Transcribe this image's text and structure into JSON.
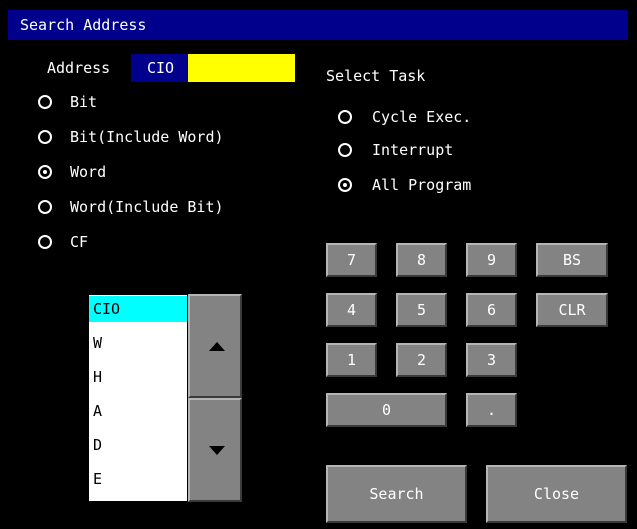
{
  "title": "Search Address",
  "address": {
    "label": "Address",
    "area": "CIO",
    "value": ""
  },
  "modes": [
    {
      "label": "Bit",
      "selected": false
    },
    {
      "label": "Bit(Include Word)",
      "selected": false
    },
    {
      "label": "Word",
      "selected": true
    },
    {
      "label": "Word(Include Bit)",
      "selected": false
    },
    {
      "label": "CF",
      "selected": false
    }
  ],
  "task": {
    "label": "Select Task",
    "options": [
      {
        "label": "Cycle Exec.",
        "selected": false
      },
      {
        "label": "Interrupt",
        "selected": false
      },
      {
        "label": "All Program",
        "selected": true
      }
    ]
  },
  "keypad": {
    "k7": "7",
    "k8": "8",
    "k9": "9",
    "bs": "BS",
    "k4": "4",
    "k5": "5",
    "k6": "6",
    "clr": "CLR",
    "k1": "1",
    "k2": "2",
    "k3": "3",
    "k0": "0",
    "dot": "."
  },
  "area_list": {
    "items": [
      "CIO",
      "W",
      "H",
      "A",
      "D",
      "E"
    ],
    "selected_index": 0
  },
  "actions": {
    "search": "Search",
    "close": "Close"
  },
  "colors": {
    "title_bar": "#00008c",
    "panel_bg": "#000000",
    "address_input_bg": "#ffff00",
    "list_selection": "#00ffff",
    "key_face": "#838383"
  },
  "icons": {
    "scroll_up": "triangle-up-icon",
    "scroll_down": "triangle-down-icon"
  }
}
